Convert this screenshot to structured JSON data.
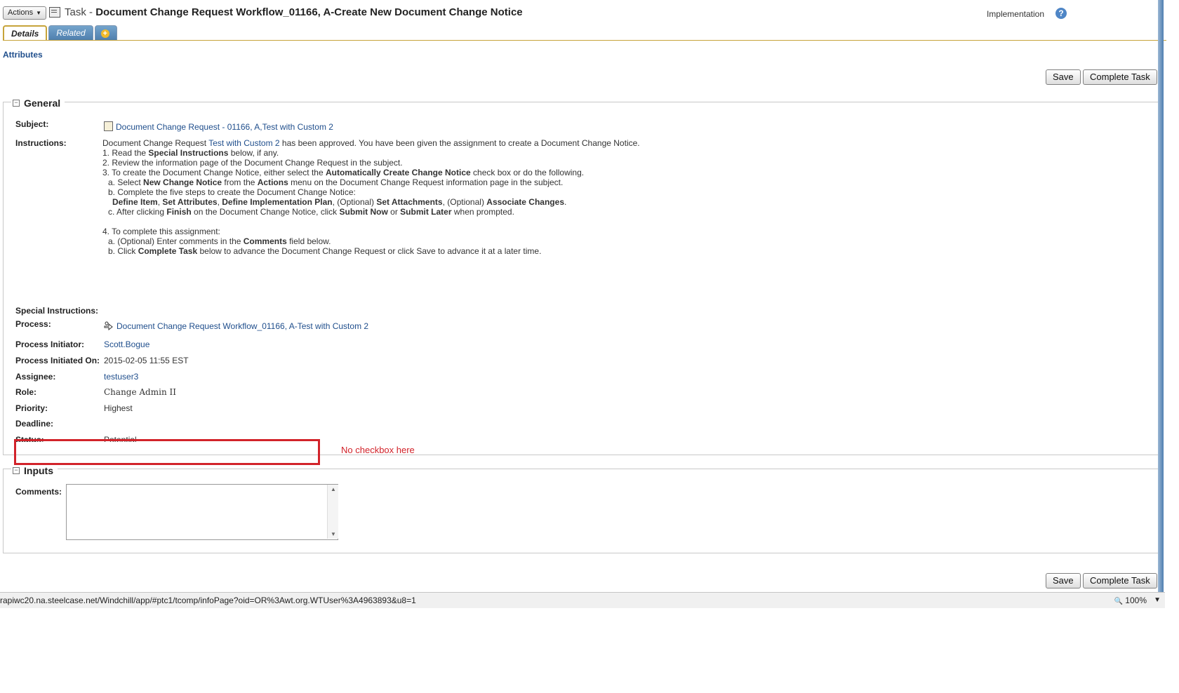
{
  "header": {
    "actions_label": "Actions",
    "title_prefix": "Task - ",
    "title_main": "Document Change Request Workflow_01166, A-Create New Document Change Notice",
    "implementation_label": "Implementation",
    "help_symbol": "?"
  },
  "tabs": [
    {
      "label": "Details"
    },
    {
      "label": "Related"
    },
    {
      "label": "+"
    }
  ],
  "attributes_label": "Attributes",
  "buttons": {
    "save": "Save",
    "complete": "Complete Task"
  },
  "general": {
    "legend": "General",
    "collapse_symbol": "⊟",
    "subject": {
      "label": "Subject:",
      "value": "Document Change Request - 01166, A,Test with Custom 2"
    },
    "instructions_label": "Instructions:",
    "special_instructions_label": "Special Instructions:",
    "process": {
      "label": "Process:",
      "value": "Document Change Request Workflow_01166, A-Test with Custom 2"
    },
    "initiator": {
      "label": "Process Initiator:",
      "value": "Scott.Bogue"
    },
    "initiated_on": {
      "label": "Process Initiated On:",
      "value": "2015-02-05 11:55 EST"
    },
    "assignee": {
      "label": "Assignee:",
      "value": "testuser3"
    },
    "role": {
      "label": "Role:",
      "value": "Change Admin II"
    },
    "priority": {
      "label": "Priority:",
      "value": "Highest"
    },
    "deadline": {
      "label": "Deadline:",
      "value": ""
    },
    "status": {
      "label": "Status:",
      "value": "Potential"
    }
  },
  "instructions": {
    "l1_a": "Document Change Request ",
    "l1_link": "Test with Custom 2",
    "l1_b": " has been approved. You have been given the assignment to create a Document Change Notice.",
    "l2_a": "1. Read the ",
    "l2_b": "Special Instructions",
    "l2_c": " below, if any.",
    "l3": "2. Review the information page of the Document Change Request in the subject.",
    "l4_a": "3. To create the Document Change Notice, either select the ",
    "l4_b": "Automatically Create Change Notice",
    "l4_c": " check box or do the following.",
    "l5_a": "  a. Select ",
    "l5_b": "New Change Notice",
    "l5_c": " from the ",
    "l5_d": "Actions",
    "l5_e": " menu on the Document Change Request information page in the subject.",
    "l6": "  b. Complete the five steps to create the Document Change Notice:",
    "l7_a": "Define Item",
    "l7_b": ", ",
    "l7_c": "Set Attributes",
    "l7_d": ", ",
    "l7_e": "Define Implementation Plan",
    "l7_f": ", (Optional) ",
    "l7_g": "Set Attachments",
    "l7_h": ", (Optional) ",
    "l7_i": "Associate Changes",
    "l7_j": ".",
    "l8_a": "  c. After clicking ",
    "l8_b": "Finish",
    "l8_c": " on the Document Change Notice, click ",
    "l8_d": "Submit Now",
    "l8_e": " or ",
    "l8_f": "Submit Later",
    "l8_g": " when prompted.",
    "l9": "4. To complete this assignment:",
    "l10_a": "  a. (Optional) Enter comments in the ",
    "l10_b": "Comments",
    "l10_c": " field below.",
    "l11_a": "  b. Click ",
    "l11_b": "Complete Task",
    "l11_c": " below to advance the Document Change Request or click Save to advance it at a later time."
  },
  "inputs": {
    "legend": "Inputs",
    "collapse_symbol": "⊟",
    "comments_label": "Comments:",
    "comments_value": ""
  },
  "annotation": {
    "text": "No checkbox here"
  },
  "statusbar": {
    "url": "rapiwc20.na.steelcase.net/Windchill/app/#ptc1/tcomp/infoPage?oid=OR%3Awt.org.WTUser%3A4963893&u8=1",
    "zoom": "100%",
    "zoom_icon": "🔍"
  },
  "colors": {
    "link": "#1f4e8c",
    "annotation": "#d2232a",
    "tab_active_border": "#c7a43a"
  }
}
